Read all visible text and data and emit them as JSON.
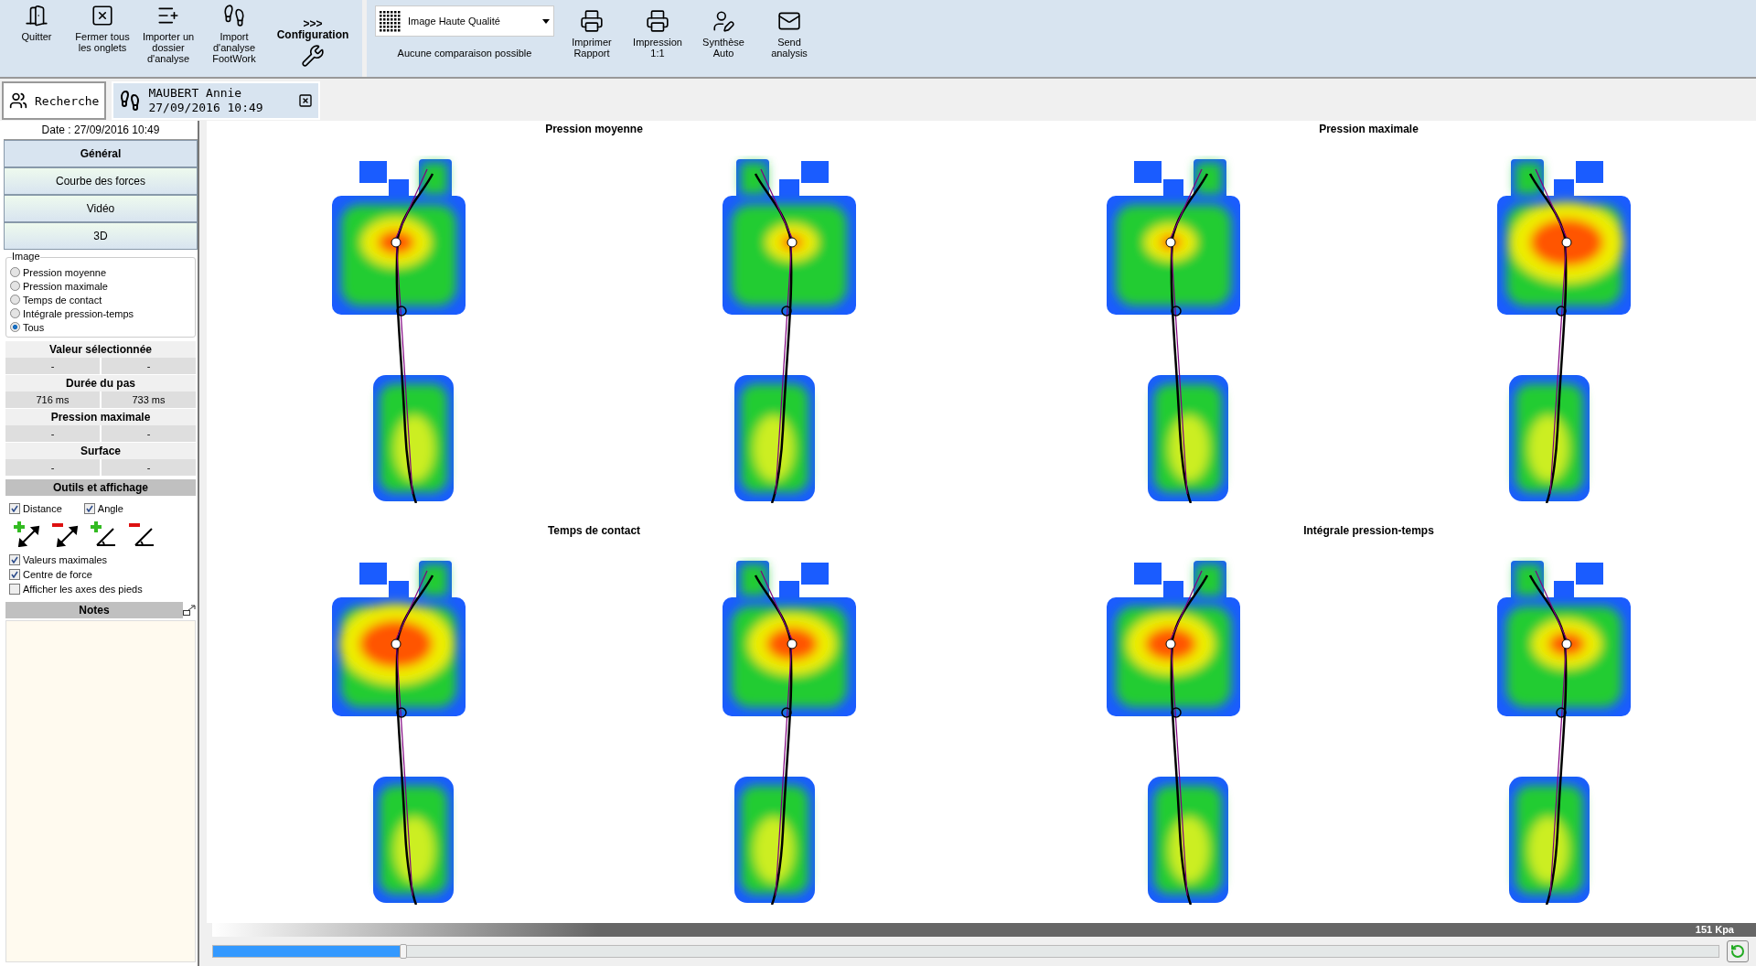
{
  "toolbar": {
    "left_buttons": [
      {
        "kind": "quit",
        "label": "Quitter"
      },
      {
        "kind": "close_all",
        "label": "Fermer tous les onglets"
      },
      {
        "kind": "import_folder",
        "label": "Importer un dossier d'analyse"
      },
      {
        "kind": "import_footwork",
        "label": "Import d'analyse FootWork"
      }
    ],
    "configuration": {
      "arrows": ">>>",
      "label": "Configuration"
    },
    "quality_select": {
      "value": "Image Haute Qualité"
    },
    "comparison_note": "Aucune comparaison possible",
    "right_buttons": [
      {
        "kind": "print",
        "label": "Imprimer Rapport"
      },
      {
        "kind": "print_1_1",
        "label": "Impression 1:1"
      },
      {
        "kind": "synthesis",
        "label": "Synthèse Auto"
      },
      {
        "kind": "mail",
        "label": "Send analysis"
      }
    ]
  },
  "tabs": [
    {
      "kind": "search",
      "label": "Recherche",
      "selected": false
    },
    {
      "kind": "patient",
      "name": "MAUBERT Annie",
      "date": "27/09/2016 10:49",
      "selected": true
    }
  ],
  "sidebar": {
    "date": "Date : 27/09/2016 10:49",
    "nav": [
      {
        "label": "Général",
        "selected": true
      },
      {
        "label": "Courbe des forces",
        "selected": false
      },
      {
        "label": "Vidéo",
        "selected": false
      },
      {
        "label": "3D",
        "selected": false
      }
    ],
    "image_group": {
      "title": "Image",
      "options": [
        {
          "label": "Pression moyenne",
          "selected": false
        },
        {
          "label": "Pression maximale",
          "selected": false
        },
        {
          "label": "Temps de contact",
          "selected": false
        },
        {
          "label": "Intégrale pression-temps",
          "selected": false
        },
        {
          "label": "Tous",
          "selected": true
        }
      ]
    },
    "metrics": [
      {
        "title": "Valeur sélectionnée",
        "values": [
          "-",
          "-"
        ]
      },
      {
        "title": "Durée du pas",
        "values": [
          "716 ms",
          "733 ms"
        ]
      },
      {
        "title": "Pression maximale",
        "values": [
          "-",
          "-"
        ]
      },
      {
        "title": "Surface",
        "values": [
          "-",
          "-"
        ]
      }
    ],
    "tools": {
      "title": "Outils et affichage",
      "measures": [
        {
          "label": "Distance",
          "checked": true
        },
        {
          "label": "Angle",
          "checked": true
        }
      ],
      "options": [
        {
          "label": "Valeurs maximales",
          "checked": true
        },
        {
          "label": "Centre de force",
          "checked": true
        },
        {
          "label": "Afficher les axes des pieds",
          "checked": false
        }
      ]
    },
    "notes": {
      "title": "Notes"
    }
  },
  "panels": [
    {
      "title": "Pression moyenne"
    },
    {
      "title": "Pression maximale"
    },
    {
      "title": "Temps de contact"
    },
    {
      "title": "Intégrale pression-temps"
    }
  ],
  "legend": {
    "max_label": "151 Kpa"
  },
  "timeline": {
    "level": 0.124
  }
}
